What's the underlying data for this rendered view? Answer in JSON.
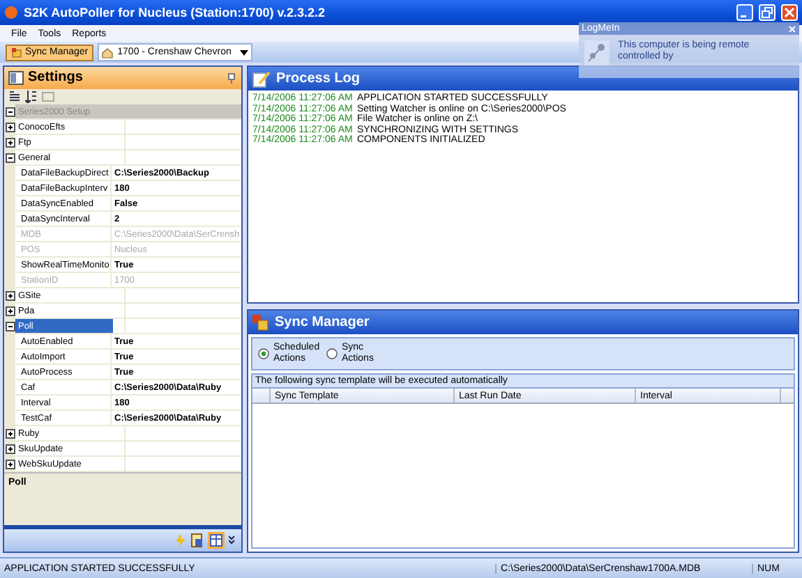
{
  "window": {
    "title": "S2K AutoPoller for Nucleus (Station:1700) v.2.3.2.2"
  },
  "menu": [
    "File",
    "Tools",
    "Reports"
  ],
  "toolbar": {
    "button": "Sync Manager",
    "station": "1700 - Crenshaw Chevron"
  },
  "settings": {
    "title": "Settings",
    "root": {
      "label": "Series2000 Setup",
      "expanded": true
    },
    "categories": [
      {
        "name": "ConocoEfts",
        "expanded": false,
        "selected": false
      },
      {
        "name": "Ftp",
        "expanded": false,
        "selected": false
      },
      {
        "name": "General",
        "expanded": true,
        "selected": false,
        "children": [
          {
            "name": "DataFileBackupDirect",
            "value": "C:\\Series2000\\Backup",
            "disabled": false
          },
          {
            "name": "DataFileBackupInterv",
            "value": "180",
            "disabled": false
          },
          {
            "name": "DataSyncEnabled",
            "value": "False",
            "disabled": false
          },
          {
            "name": "DataSyncInterval",
            "value": "2",
            "disabled": false
          },
          {
            "name": "MDB",
            "value": "C:\\Series2000\\Data\\SerCrensh",
            "disabled": true
          },
          {
            "name": "POS",
            "value": "Nucleus",
            "disabled": true
          },
          {
            "name": "ShowRealTimeMonito",
            "value": "True",
            "disabled": false
          },
          {
            "name": "StationID",
            "value": "1700",
            "disabled": true
          }
        ]
      },
      {
        "name": "GSite",
        "expanded": false,
        "selected": false
      },
      {
        "name": "Pda",
        "expanded": false,
        "selected": false
      },
      {
        "name": "Poll",
        "expanded": true,
        "selected": true,
        "children": [
          {
            "name": "AutoEnabled",
            "value": "True",
            "disabled": false
          },
          {
            "name": "AutoImport",
            "value": "True",
            "disabled": false
          },
          {
            "name": "AutoProcess",
            "value": "True",
            "disabled": false
          },
          {
            "name": "Caf",
            "value": "C:\\Series2000\\Data\\Ruby",
            "disabled": false
          },
          {
            "name": "Interval",
            "value": "180",
            "disabled": false
          },
          {
            "name": "TestCaf",
            "value": "C:\\Series2000\\Data\\Ruby",
            "disabled": false
          }
        ]
      },
      {
        "name": "Ruby",
        "expanded": false,
        "selected": false
      },
      {
        "name": "SkuUpdate",
        "expanded": false,
        "selected": false
      },
      {
        "name": "WebSkuUpdate",
        "expanded": false,
        "selected": false
      }
    ],
    "description": "Poll"
  },
  "process_log": {
    "title": "Process Log",
    "entries": [
      {
        "time": "7/14/2006 11:27:06 AM",
        "message": "APPLICATION STARTED SUCCESSFULLY"
      },
      {
        "time": "7/14/2006 11:27:06 AM",
        "message": "Setting Watcher is online on C:\\Series2000\\POS"
      },
      {
        "time": "7/14/2006 11:27:06 AM",
        "message": "File Watcher is online on Z:\\"
      },
      {
        "time": "7/14/2006 11:27:06 AM",
        "message": "SYNCHRONIZING WITH SETTINGS"
      },
      {
        "time": "7/14/2006 11:27:06 AM",
        "message": "COMPONENTS INITIALIZED"
      }
    ]
  },
  "sync_manager": {
    "title": "Sync Manager",
    "options": [
      {
        "label": "Scheduled Actions",
        "selected": true
      },
      {
        "label": "Sync Actions",
        "selected": false
      }
    ],
    "info": "The following sync template will be executed automatically",
    "columns": [
      "Sync Template",
      "Last Run Date",
      "Interval"
    ]
  },
  "status_bar": {
    "message": "APPLICATION STARTED SUCCESSFULLY",
    "path": "C:\\Series2000\\Data\\SerCrenshaw1700A.MDB",
    "indicator": "NUM"
  },
  "popup": {
    "title": "LogMeIn",
    "message": "This computer is being remote controlled by"
  }
}
